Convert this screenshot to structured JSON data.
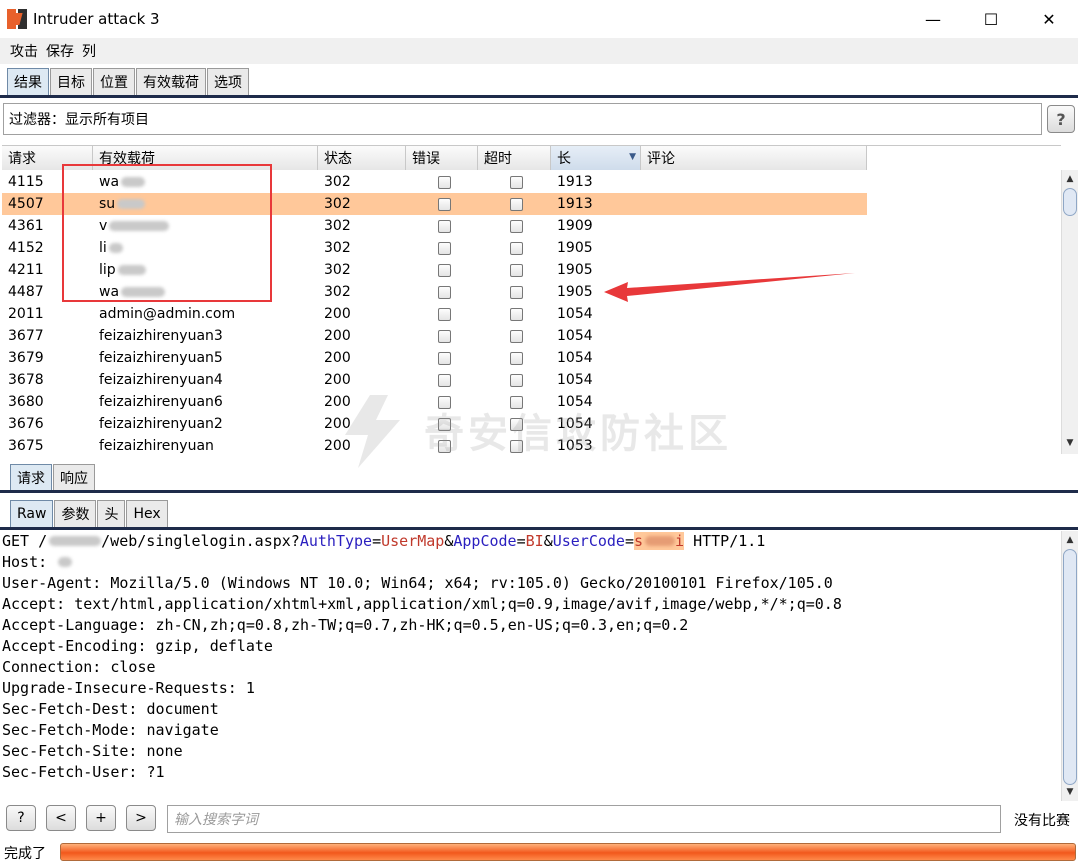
{
  "window": {
    "title": "Intruder attack 3",
    "minimize": "—",
    "maximize": "☐",
    "close": "✕"
  },
  "menu": [
    "攻击",
    "保存",
    "列"
  ],
  "main_tabs": [
    "结果",
    "目标",
    "位置",
    "有效载荷",
    "选项"
  ],
  "filter": {
    "label": "过滤器：",
    "value": "显示所有项目",
    "help": "?"
  },
  "table": {
    "columns": [
      "请求",
      "有效载荷",
      "状态",
      "错误",
      "超时",
      "长",
      "评论"
    ],
    "sorted_column": "长",
    "rows": [
      {
        "request": "4115",
        "payload": "wa",
        "status": "302",
        "length": "1913"
      },
      {
        "request": "4507",
        "payload": "su",
        "status": "302",
        "length": "1913",
        "selected": true
      },
      {
        "request": "4361",
        "payload": "v",
        "status": "302",
        "length": "1909"
      },
      {
        "request": "4152",
        "payload": "li",
        "status": "302",
        "length": "1905"
      },
      {
        "request": "4211",
        "payload": "lip",
        "status": "302",
        "length": "1905"
      },
      {
        "request": "4487",
        "payload": "wa",
        "status": "302",
        "length": "1905"
      },
      {
        "request": "2011",
        "payload": "admin@admin.com",
        "status": "200",
        "length": "1054"
      },
      {
        "request": "3677",
        "payload": "feizaizhirenyuan3",
        "status": "200",
        "length": "1054"
      },
      {
        "request": "3679",
        "payload": "feizaizhirenyuan5",
        "status": "200",
        "length": "1054"
      },
      {
        "request": "3678",
        "payload": "feizaizhirenyuan4",
        "status": "200",
        "length": "1054"
      },
      {
        "request": "3680",
        "payload": "feizaizhirenyuan6",
        "status": "200",
        "length": "1054"
      },
      {
        "request": "3676",
        "payload": "feizaizhirenyuan2",
        "status": "200",
        "length": "1054"
      },
      {
        "request": "3675",
        "payload": "feizaizhirenyuan",
        "status": "200",
        "length": "1053"
      }
    ]
  },
  "watermark": "奇安信攻防社区",
  "sub_tabs": [
    "请求",
    "响应"
  ],
  "view_tabs": [
    "Raw",
    "参数",
    "头",
    "Hex"
  ],
  "request": {
    "line1": {
      "prefix": "GET /",
      "path": "/web/singlelogin.aspx?",
      "k1": "AuthType",
      "eq": "=",
      "v1": "UserMap",
      "amp": "&",
      "k2": "AppCode",
      "v2": "BI",
      "k3": "UserCode",
      "v3": "s",
      "v3b": "i",
      "suffix": " HTTP/1.1"
    },
    "host": "Host: ",
    "lines": [
      "User-Agent: Mozilla/5.0 (Windows NT 10.0; Win64; x64; rv:105.0) Gecko/20100101 Firefox/105.0",
      "Accept: text/html,application/xhtml+xml,application/xml;q=0.9,image/avif,image/webp,*/*;q=0.8",
      "Accept-Language: zh-CN,zh;q=0.8,zh-TW;q=0.7,zh-HK;q=0.5,en-US;q=0.3,en;q=0.2",
      "Accept-Encoding: gzip, deflate",
      "Connection: close",
      "Upgrade-Insecure-Requests: 1",
      "Sec-Fetch-Dest: document",
      "Sec-Fetch-Mode: navigate",
      "Sec-Fetch-Site: none",
      "Sec-Fetch-User: ?1"
    ]
  },
  "search": {
    "help": "?",
    "prev": "<",
    "add": "+",
    "next": ">",
    "placeholder": "输入搜索字词",
    "result": "没有比赛"
  },
  "status": {
    "text": "完成了",
    "progress": 1.0
  },
  "colors": {
    "selected_row": "#ffc89a",
    "annotation_red": "#e8383a",
    "progress": "#f2581c"
  }
}
